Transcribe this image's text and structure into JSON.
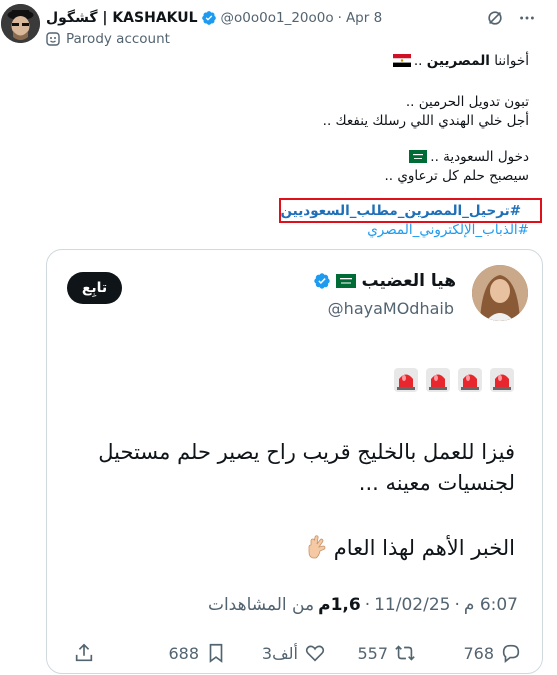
{
  "post": {
    "author": {
      "display_name": "گشگول | KASHAKUL",
      "handle": "@o0o0o1_20o0o",
      "date": "Apr 8",
      "label": "Parody account"
    },
    "text": {
      "line1_prefix": "أخواننا ",
      "line1_bold": "المصريين",
      "line1_suffix": " ..",
      "line2": "تبون تدويل الحرمين ..",
      "line3": "أجل خلي الهندي اللي رسلك ينفعك ..",
      "line4": "دخول السعودية ..",
      "line5": "سيصبح حلم كل ترعاوي .."
    },
    "hashtags": [
      "#ترحيل_المصرين_مطلب_السعوديين",
      "#الذباب_الإلكتروني_المصري"
    ],
    "quoted": {
      "display_name": "هيا العضيب",
      "handle": "@hayaMOdhaib",
      "follow_label": "تابِع",
      "sirens_count": 4,
      "line1": "فيزا للعمل بالخليج قريب راح يصير حلم مستحيل",
      "line2": "لجنسيات معينه ...",
      "line3": "الخبر الأهم لهذا العام",
      "time": "6:07 م",
      "date": "11/02/25",
      "sep": "·",
      "views_count": "1,6م",
      "views_label": "من المشاهدات",
      "replies": "768",
      "reposts": "557",
      "likes": "3ألف",
      "bookmarks": "688"
    }
  },
  "colors": {
    "accent": "#1d9bf0",
    "highlight_box": "#e0101a",
    "muted": "#536471"
  },
  "icons": [
    "verified-badge-icon",
    "grok-icon",
    "more-icon",
    "parody-icon",
    "egypt-flag-icon",
    "saudi-flag-icon",
    "siren-icon",
    "hand-icon",
    "reply-icon",
    "repost-icon",
    "like-icon",
    "bookmark-icon",
    "share-icon"
  ]
}
